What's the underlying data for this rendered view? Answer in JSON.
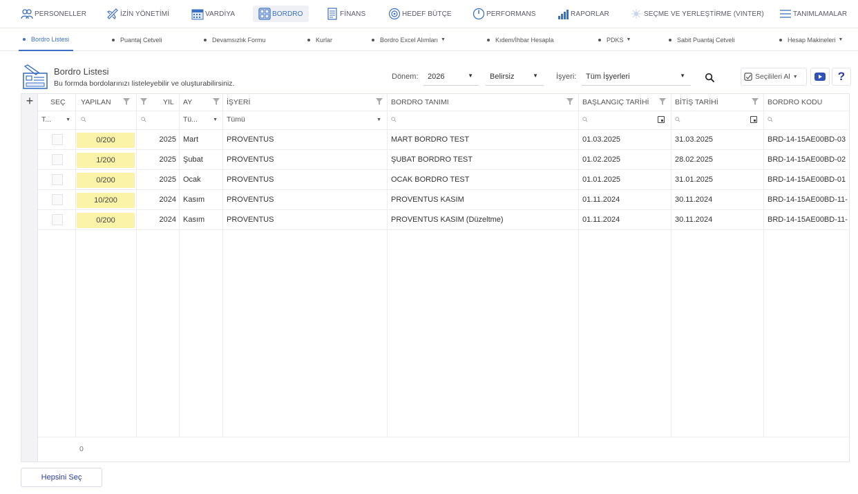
{
  "topnav": {
    "items": [
      {
        "label": "PERSONELLER",
        "icon": "people-icon"
      },
      {
        "label": "İZİN YÖNETİMİ",
        "icon": "plane-icon"
      },
      {
        "label": "VARDİYA",
        "icon": "calendar-icon"
      },
      {
        "label": "BORDRO",
        "icon": "grid-icon"
      },
      {
        "label": "FİNANS",
        "icon": "document-icon"
      },
      {
        "label": "HEDEF BÜTÇE",
        "icon": "target-icon"
      },
      {
        "label": "PERFORMANS",
        "icon": "gauge-icon"
      },
      {
        "label": "RAPORLAR",
        "icon": "bar-chart-icon"
      },
      {
        "label": "SEÇME VE YERLEŞTİRME (VINTER)",
        "icon": "sparkle-icon"
      },
      {
        "label": "TANIMLAMALAR",
        "icon": "menu-icon"
      }
    ],
    "active": "BORDRO"
  },
  "subnav": {
    "items": [
      {
        "label": "Bordro Listesi",
        "dropdown": false
      },
      {
        "label": "Puantaj Cetveli",
        "dropdown": false
      },
      {
        "label": "Devamsızlık Formu",
        "dropdown": false
      },
      {
        "label": "Kurlar",
        "dropdown": false
      },
      {
        "label": "Bordro Excel Alımları",
        "dropdown": true
      },
      {
        "label": "Kıdem/İhbar Hesapla",
        "dropdown": false
      },
      {
        "label": "PDKS",
        "dropdown": true
      },
      {
        "label": "Sabit Puantaj Cetveli",
        "dropdown": false
      },
      {
        "label": "Hesap Makineleri",
        "dropdown": true
      }
    ],
    "active": "Bordro Listesi"
  },
  "header": {
    "title": "Bordro Listesi",
    "description": "Bu formda bordolarınızı listeleyebilir ve oluşturabilirsiniz."
  },
  "filters": {
    "donem_label": "Dönem:",
    "donem_value": "2026",
    "period_value": "Belirsiz",
    "isyeri_label": "İşyeri:",
    "isyeri_value": "Tüm İşyerleri",
    "selected_actions_label": "Seçilileri Al"
  },
  "grid": {
    "columns": {
      "sec": "SEÇ",
      "yapilan": "YAPILAN",
      "yil": "YIL",
      "ay": "AY",
      "isyeri": "İŞYERİ",
      "tanim": "BORDRO TANIMI",
      "baslangic": "BAŞLANGIÇ TARİHİ",
      "bitis": "BİTİŞ TARİHİ",
      "kod": "BORDRO KODU"
    },
    "filter_row": {
      "sec": "T...",
      "ay": "Tü...",
      "isyeri": "Tümü"
    },
    "rows": [
      {
        "yapilan": "0/200",
        "yil": "2025",
        "ay": "Mart",
        "isyeri": "PROVENTUS",
        "tanim": "MART BORDRO TEST",
        "baslangic": "01.03.2025",
        "bitis": "31.03.2025",
        "kod": "BRD-14-15AE00BD-03"
      },
      {
        "yapilan": "1/200",
        "yil": "2025",
        "ay": "Şubat",
        "isyeri": "PROVENTUS",
        "tanim": "ŞUBAT BORDRO TEST",
        "baslangic": "01.02.2025",
        "bitis": "28.02.2025",
        "kod": "BRD-14-15AE00BD-02"
      },
      {
        "yapilan": "0/200",
        "yil": "2025",
        "ay": "Ocak",
        "isyeri": "PROVENTUS",
        "tanim": "OCAK BORDRO TEST",
        "baslangic": "01.01.2025",
        "bitis": "31.01.2025",
        "kod": "BRD-14-15AE00BD-01"
      },
      {
        "yapilan": "10/200",
        "yil": "2024",
        "ay": "Kasım",
        "isyeri": "PROVENTUS",
        "tanim": "PROVENTUS KASIM",
        "baslangic": "01.11.2024",
        "bitis": "30.11.2024",
        "kod": "BRD-14-15AE00BD-11-"
      },
      {
        "yapilan": "0/200",
        "yil": "2024",
        "ay": "Kasım",
        "isyeri": "PROVENTUS",
        "tanim": "PROVENTUS KASIM (Düzeltme)",
        "baslangic": "01.11.2024",
        "bitis": "30.11.2024",
        "kod": "BRD-14-15AE00BD-11-"
      }
    ],
    "footer_count": "0"
  },
  "buttons": {
    "select_all": "Hepsini Seç"
  },
  "colors": {
    "accent": "#3a6fc4",
    "help": "#2b3aa0",
    "progress_bg": "#fbf3a8",
    "youtube": "#3153b8"
  }
}
